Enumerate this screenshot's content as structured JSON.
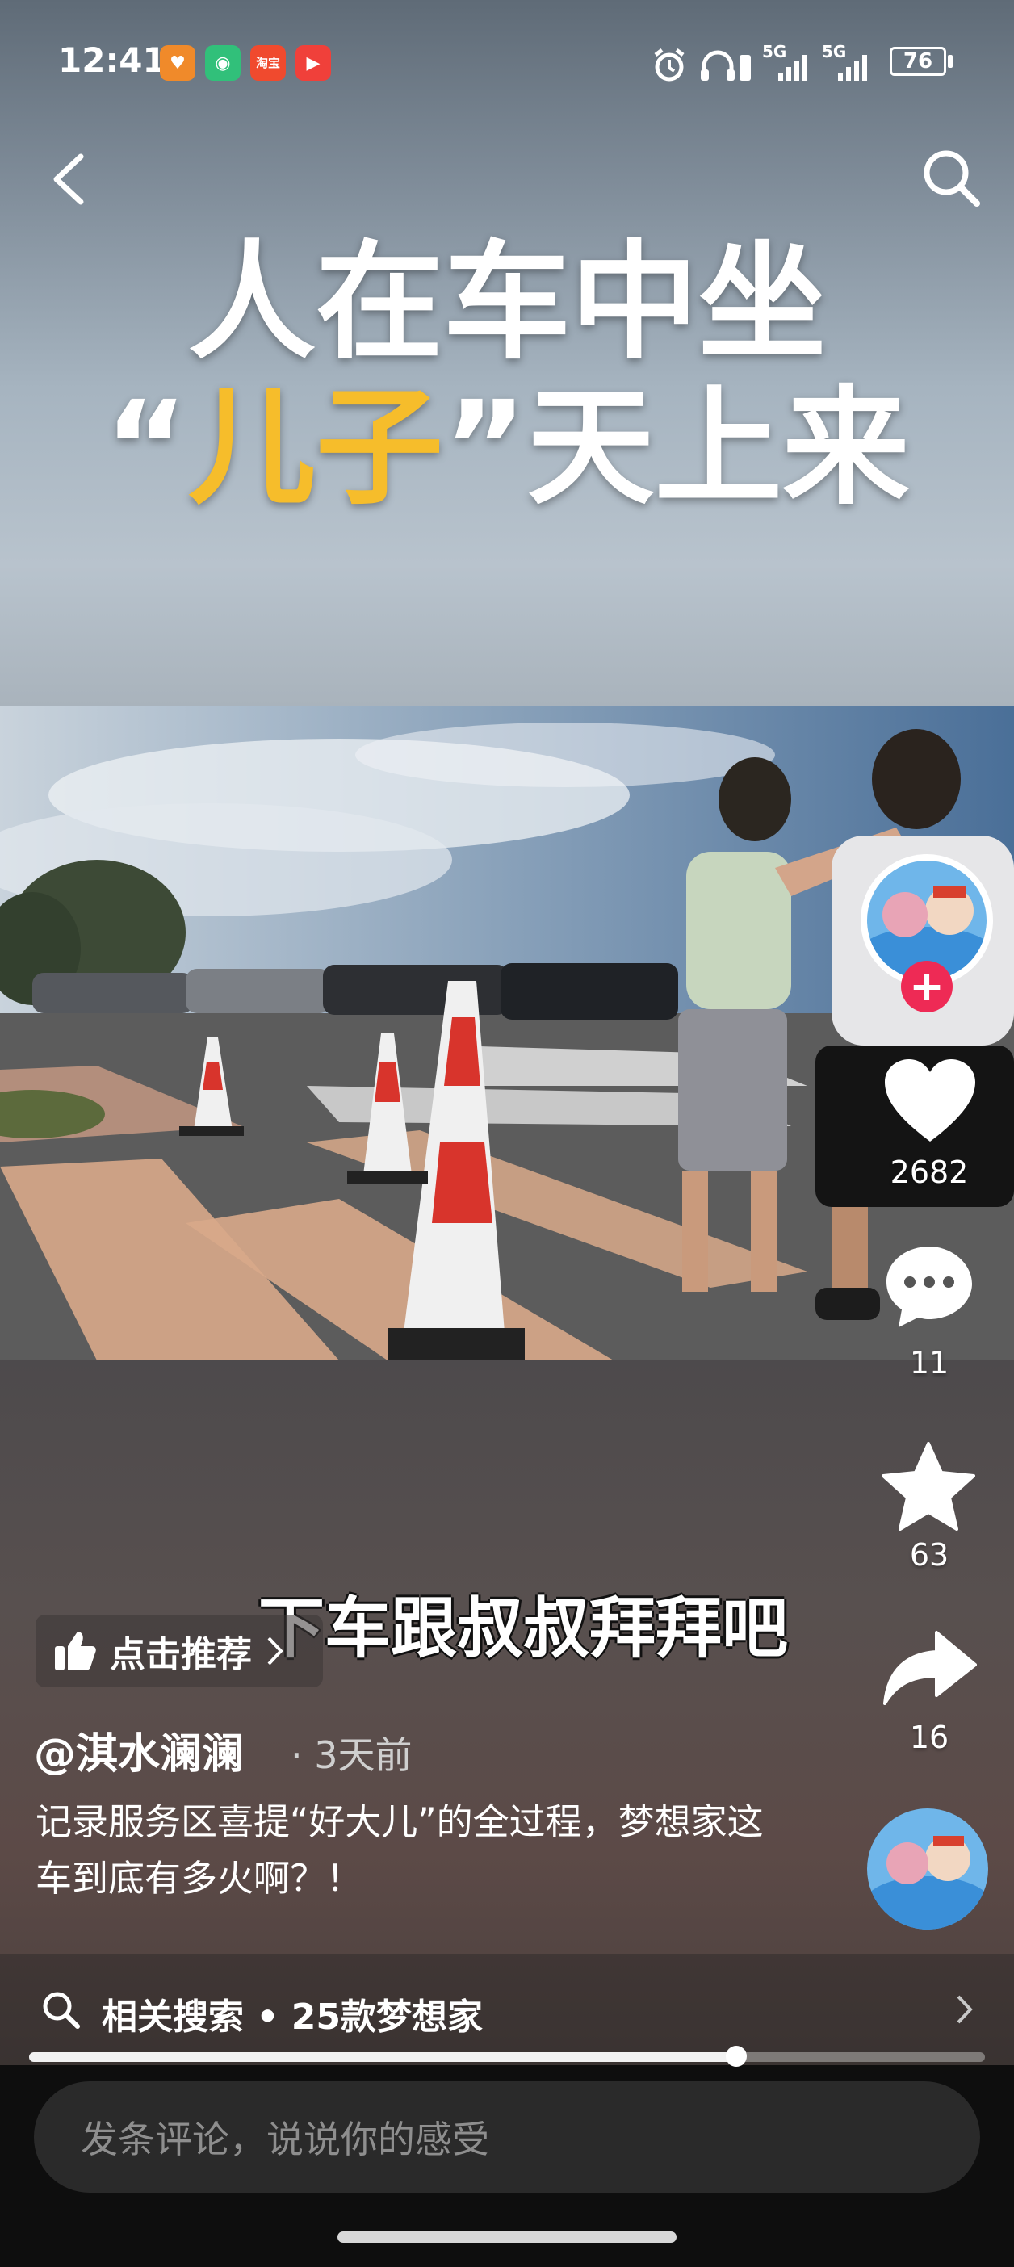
{
  "status_bar": {
    "time": "12:41",
    "app_badges": [
      {
        "icon": "heart-app-icon",
        "color": "#f08a2a",
        "text": "♥"
      },
      {
        "icon": "shield-app-icon",
        "color": "#31c07a",
        "text": "◉"
      },
      {
        "icon": "taobao-app-icon",
        "color": "#f04a2e",
        "text": "淘宝"
      },
      {
        "icon": "video-app-icon",
        "color": "#f0403a",
        "text": "▶"
      }
    ],
    "network_1": "5G",
    "network_2": "5G",
    "battery": "76"
  },
  "title": {
    "line1": "人在车中坐",
    "line2_prefix": "“",
    "line2_highlight": "儿子",
    "line2_suffix": "”天上来"
  },
  "subtitle": "下车跟叔叔拜拜吧",
  "actions": {
    "likes": "2682",
    "comments": "11",
    "favorites": "63",
    "shares": "16"
  },
  "recommend_label": "点击推荐",
  "author": "@淇水澜澜",
  "time_ago": "· 3天前",
  "description": "记录服务区喜提“好大儿”的全过程，梦想家这车到底有多火啊？！",
  "related_search": {
    "prefix": "相关搜索",
    "dot": "•",
    "query": "25款梦想家"
  },
  "progress_fraction": 0.74,
  "comment_placeholder": "发条评论，说说你的感受",
  "colors": {
    "title_highlight": "#f6bd2b",
    "follow_button": "#ee2a55"
  }
}
